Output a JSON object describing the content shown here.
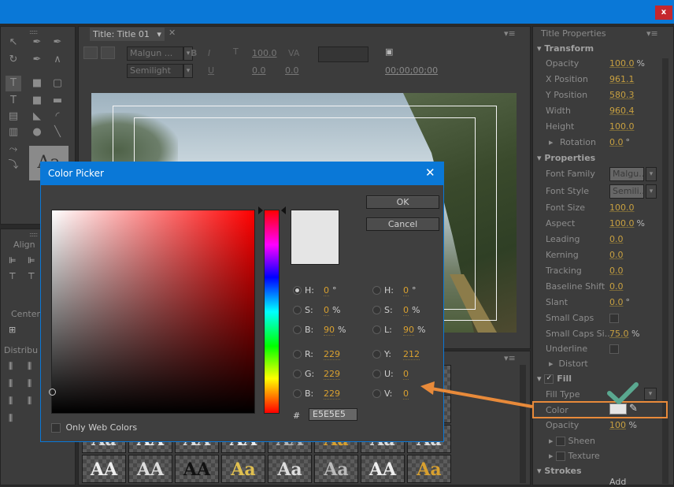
{
  "window": {
    "close_label": "x"
  },
  "title_tab": {
    "label": "Title: Title 01"
  },
  "toolbar": {
    "font_family": "Malgun ...",
    "font_style": "Semilight",
    "bold": "B",
    "italic": "I",
    "underline": "U",
    "size_value": "100.0",
    "kerning_value": "0.0",
    "leading_value": "0.0",
    "tracking_value": "0.0",
    "timecode": "00;00;00;00"
  },
  "tools_panel": {
    "sample_label": "Aa"
  },
  "align_panel": {
    "align": "Align",
    "center": "Center",
    "distribute": "Distribu"
  },
  "title_properties": {
    "header": "Title Properties",
    "transform": {
      "heading": "Transform"
    },
    "rows_transform": [
      {
        "label": "Opacity",
        "value": "100.0",
        "unit": "%"
      },
      {
        "label": "X Position",
        "value": "961.1",
        "unit": ""
      },
      {
        "label": "Y Position",
        "value": "580.3",
        "unit": ""
      },
      {
        "label": "Width",
        "value": "960.4",
        "unit": ""
      },
      {
        "label": "Height",
        "value": "100.0",
        "unit": ""
      },
      {
        "label": "Rotation",
        "value": "0.0",
        "unit": "°"
      }
    ],
    "properties": {
      "heading": "Properties"
    },
    "font_family": {
      "label": "Font Family",
      "value": "Malgu..."
    },
    "font_style": {
      "label": "Font Style",
      "value": "Semili..."
    },
    "rows_props": [
      {
        "label": "Font Size",
        "value": "100.0",
        "unit": ""
      },
      {
        "label": "Aspect",
        "value": "100.0",
        "unit": "%"
      },
      {
        "label": "Leading",
        "value": "0.0",
        "unit": ""
      },
      {
        "label": "Kerning",
        "value": "0.0",
        "unit": ""
      },
      {
        "label": "Tracking",
        "value": "0.0",
        "unit": ""
      },
      {
        "label": "Baseline Shift",
        "value": "0.0",
        "unit": ""
      },
      {
        "label": "Slant",
        "value": "0.0",
        "unit": "°"
      }
    ],
    "small_caps": "Small Caps",
    "small_caps_size": {
      "label": "Small Caps Si...",
      "value": "75.0",
      "unit": "%"
    },
    "underline": "Underline",
    "distort": "Distort",
    "fill": {
      "heading": "Fill"
    },
    "fill_type": "Fill Type",
    "color": "Color",
    "fill_opacity": {
      "label": "Opacity",
      "value": "100",
      "unit": "%"
    },
    "sheen": "Sheen",
    "texture": "Texture",
    "strokes": {
      "heading": "Strokes"
    },
    "add_stroke": "Add"
  },
  "styles": {
    "samples": [
      "Aa",
      "Aa",
      "AA",
      "Aa",
      "AA",
      "AA",
      "AA",
      "Aa",
      "Aa",
      "Aa",
      "AA",
      "AA",
      "AA",
      "AA",
      "Aa",
      "Aa",
      "Aa",
      "AA",
      "AA",
      "AA",
      "Aa"
    ]
  },
  "color_picker": {
    "title": "Color Picker",
    "ok": "OK",
    "cancel": "Cancel",
    "left": [
      {
        "label": "H:",
        "value": "0",
        "unit": "°",
        "checked": true
      },
      {
        "label": "S:",
        "value": "0",
        "unit": "%",
        "checked": false
      },
      {
        "label": "B:",
        "value": "90",
        "unit": "%",
        "checked": false
      },
      {
        "label": "R:",
        "value": "229",
        "unit": "",
        "checked": false
      },
      {
        "label": "G:",
        "value": "229",
        "unit": "",
        "checked": false
      },
      {
        "label": "B:",
        "value": "229",
        "unit": "",
        "checked": false
      }
    ],
    "right": [
      {
        "label": "H:",
        "value": "0",
        "unit": "°"
      },
      {
        "label": "S:",
        "value": "0",
        "unit": "%"
      },
      {
        "label": "L:",
        "value": "90",
        "unit": "%"
      },
      {
        "label": "Y:",
        "value": "212",
        "unit": ""
      },
      {
        "label": "U:",
        "value": "0",
        "unit": ""
      },
      {
        "label": "V:",
        "value": "0",
        "unit": ""
      }
    ],
    "hash": "#",
    "hex_value": "E5E5E5",
    "web_colors": "Only Web Colors",
    "selected_color": "#e5e5e5"
  },
  "colors": {
    "accent": "#0a78d7",
    "highlight": "#e88a3a",
    "check": "#5aa890",
    "value": "#d8a030"
  }
}
